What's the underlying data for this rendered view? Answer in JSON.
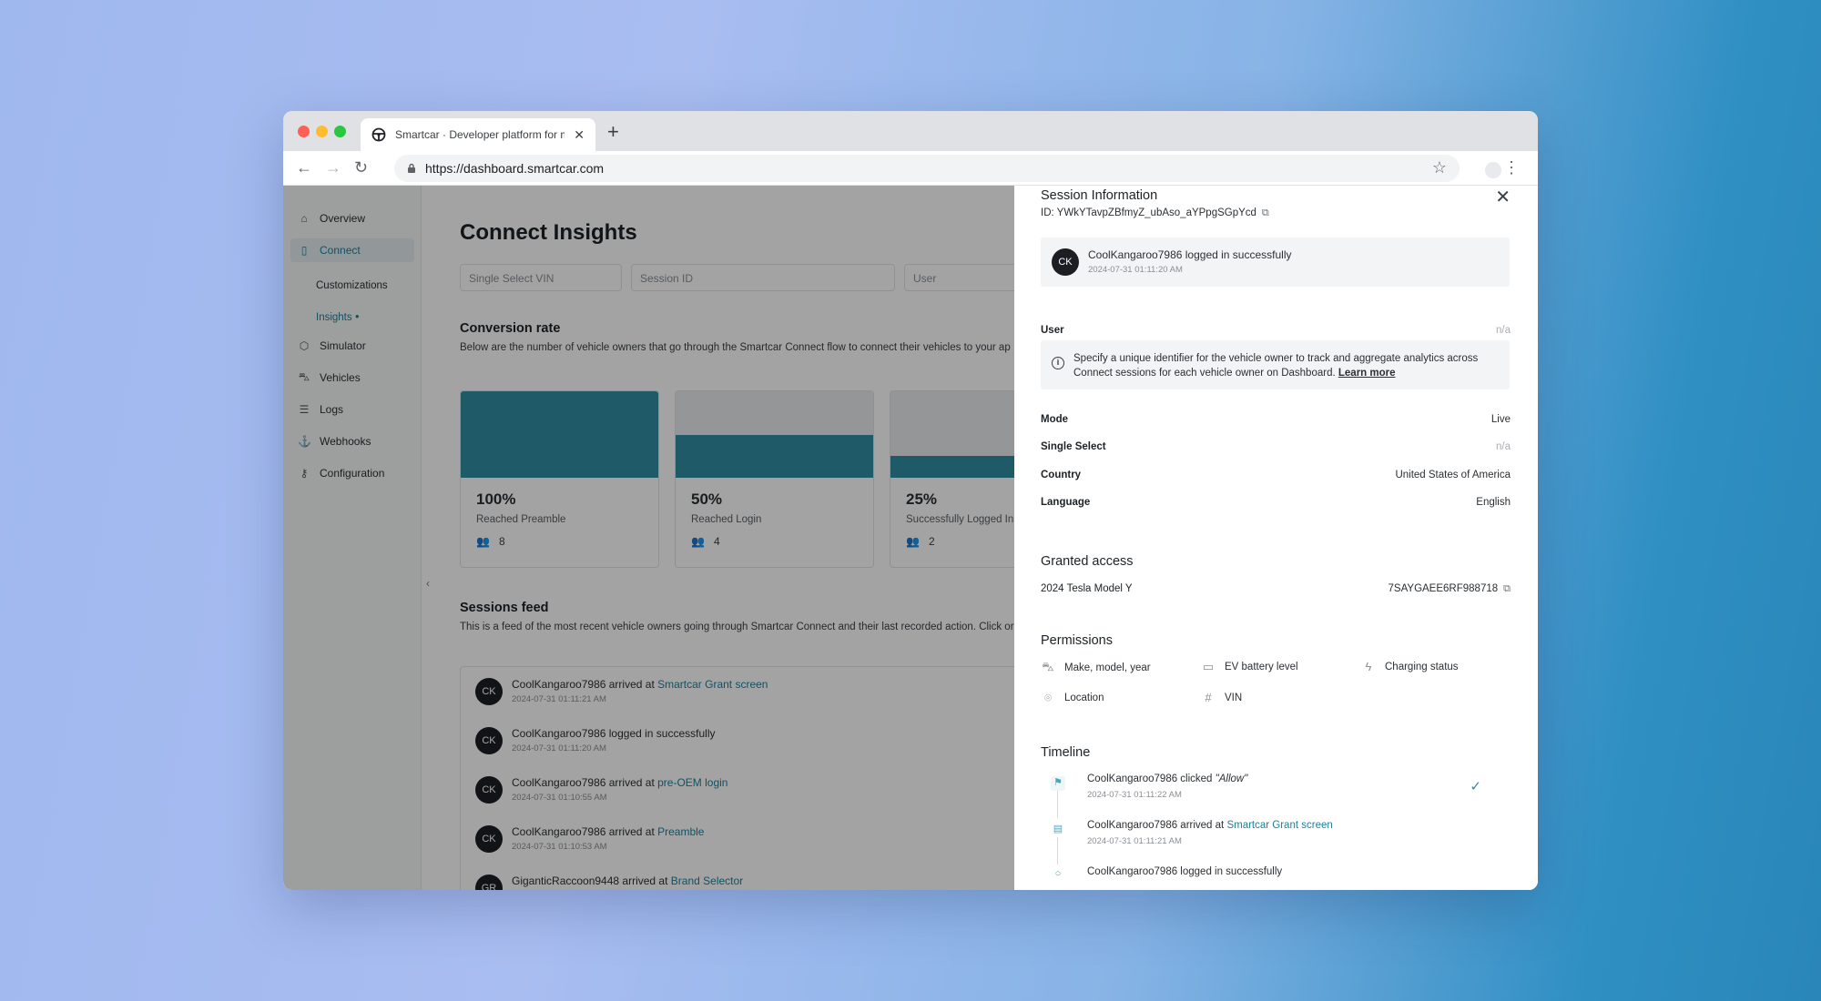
{
  "browser": {
    "tab_title": "Smartcar · Developer platform for mo",
    "url": "https://dashboard.smartcar.com",
    "new_tab_label": "+"
  },
  "sidebar": {
    "items": [
      {
        "label": "Overview",
        "icon": "home-icon"
      },
      {
        "label": "Connect",
        "icon": "phone-icon"
      },
      {
        "label": "Simulator",
        "icon": "cube-icon"
      },
      {
        "label": "Vehicles",
        "icon": "car-icon"
      },
      {
        "label": "Logs",
        "icon": "list-icon"
      },
      {
        "label": "Webhooks",
        "icon": "anchor-icon"
      },
      {
        "label": "Configuration",
        "icon": "key-icon"
      }
    ],
    "sub_items": [
      {
        "label": "Customizations"
      },
      {
        "label": "Insights"
      }
    ]
  },
  "main": {
    "title": "Connect Insights",
    "filters": [
      "Single Select VIN",
      "Session ID",
      "User"
    ],
    "conversion": {
      "title": "Conversion rate",
      "description": "Below are the number of vehicle owners that go through the Smartcar Connect flow to connect their vehicles to your ap",
      "steps": [
        {
          "pct": "100%",
          "label": "Reached Preamble",
          "count": "8",
          "fill": 1.0
        },
        {
          "pct": "50%",
          "label": "Reached Login",
          "count": "4",
          "fill": 0.5
        },
        {
          "pct": "25%",
          "label": "Successfully Logged In",
          "count": "2",
          "fill": 0.25
        }
      ]
    },
    "feed": {
      "title": "Sessions feed",
      "description": "This is a feed of the most recent vehicle owners going through Smartcar Connect and their last recorded action. Click or",
      "rows": [
        {
          "avatar": "CK",
          "text": "CoolKangaroo7986 arrived at ",
          "link": "Smartcar Grant screen",
          "time": "2024-07-31 01:11:21 AM"
        },
        {
          "avatar": "CK",
          "text": "CoolKangaroo7986 logged in successfully",
          "link": "",
          "time": "2024-07-31 01:11:20 AM"
        },
        {
          "avatar": "CK",
          "text": "CoolKangaroo7986 arrived at ",
          "link": "pre-OEM login",
          "time": "2024-07-31 01:10:55 AM"
        },
        {
          "avatar": "CK",
          "text": "CoolKangaroo7986 arrived at ",
          "link": "Preamble",
          "time": "2024-07-31 01:10:53 AM"
        },
        {
          "avatar": "GR",
          "text": "GiganticRaccoon9448 arrived at ",
          "link": "Brand Selector",
          "time": ""
        }
      ]
    }
  },
  "drawer": {
    "title": "Session Information",
    "id_text": "ID: YWkYTavpZBfmyZ_ubAso_aYPpgSGpYcd",
    "event": {
      "avatar": "CK",
      "text": "CoolKangaroo7986 logged in successfully",
      "time": "2024-07-31 01:11:20 AM"
    },
    "user_label": "User",
    "user_value": "n/a",
    "info_text": "Specify a unique identifier for the vehicle owner to track and aggregate analytics across Connect sessions for each vehicle owner on Dashboard.",
    "info_link": "Learn more",
    "mode_label": "Mode",
    "mode_value": "Live",
    "single_select_label": "Single Select",
    "single_select_value": "n/a",
    "country_label": "Country",
    "country_value": "United States of America",
    "language_label": "Language",
    "language_value": "English",
    "granted_title": "Granted access",
    "vehicle": "2024 Tesla Model Y",
    "vin": "7SAYGAEE6RF988718",
    "permissions_title": "Permissions",
    "permissions": [
      {
        "label": "Make, model, year",
        "icon": "car-icon"
      },
      {
        "label": "EV battery level",
        "icon": "battery-icon"
      },
      {
        "label": "Charging status",
        "icon": "lightning-icon"
      },
      {
        "label": "Location",
        "icon": "location-pin-icon"
      },
      {
        "label": "VIN",
        "icon": "hash-icon"
      }
    ],
    "timeline_title": "Timeline",
    "timeline": [
      {
        "text": "CoolKangaroo7986 clicked ",
        "em": "\"Allow\"",
        "link": "",
        "time": "2024-07-31 01:11:22 AM",
        "icon": "flag-icon"
      },
      {
        "text": "CoolKangaroo7986 arrived at ",
        "em": "",
        "link": "Smartcar Grant screen",
        "time": "2024-07-31 01:11:21 AM",
        "icon": "screen-icon"
      },
      {
        "text": "CoolKangaroo7986 logged in successfully",
        "em": "",
        "link": "",
        "time": "",
        "icon": "circle-icon"
      }
    ]
  },
  "colors": {
    "accent": "#2f8ea3",
    "link": "#1f7f99"
  }
}
